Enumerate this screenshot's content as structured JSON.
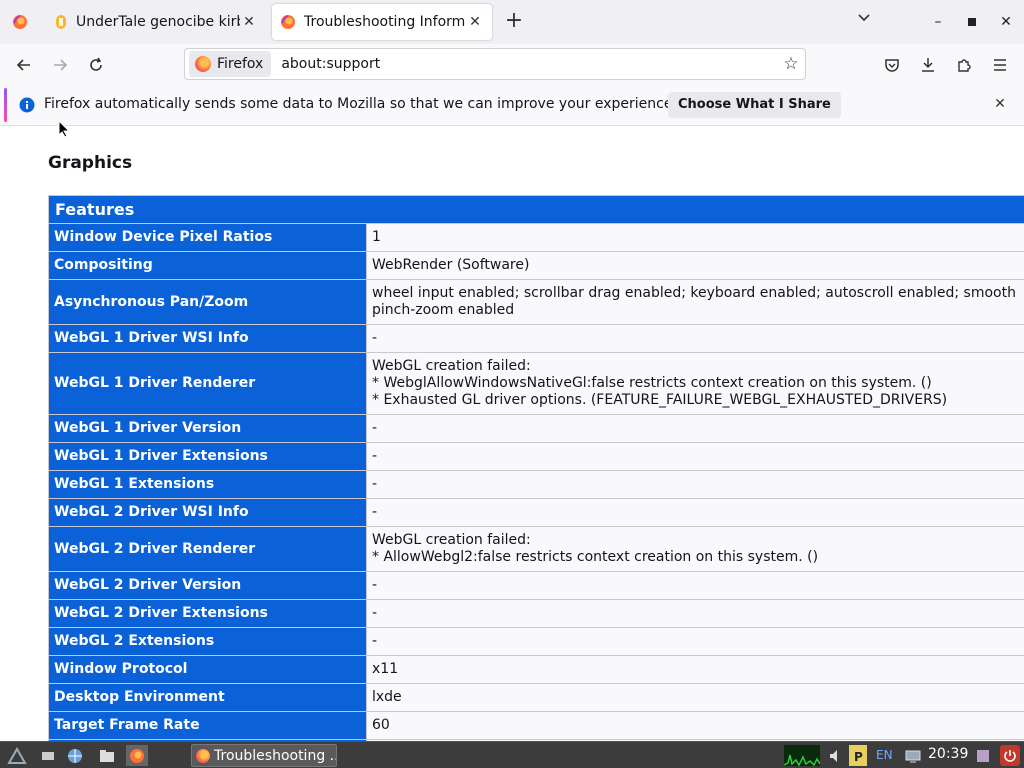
{
  "tabs": [
    {
      "title": "UnderTale genocibe kirby",
      "active": false
    },
    {
      "title": "Troubleshooting Informat",
      "active": true
    }
  ],
  "toolbar": {
    "identity_label": "Firefox",
    "url": "about:support"
  },
  "notification": {
    "message": "Firefox automatically sends some data to Mozilla so that we can improve your experience.",
    "button_label": "Choose What I Share"
  },
  "page": {
    "section_title": "Graphics",
    "table_caption": "Features",
    "rows": [
      {
        "key": "Window Device Pixel Ratios",
        "value": "1"
      },
      {
        "key": "Compositing",
        "value": "WebRender (Software)"
      },
      {
        "key": "Asynchronous Pan/Zoom",
        "value": "wheel input enabled; scrollbar drag enabled; keyboard enabled; autoscroll enabled; smooth pinch-zoom enabled"
      },
      {
        "key": "WebGL 1 Driver WSI Info",
        "value": "-"
      },
      {
        "key": "WebGL 1 Driver Renderer",
        "value": "WebGL creation failed:\n* WebglAllowWindowsNativeGl:false restricts context creation on this system. ()\n* Exhausted GL driver options. (FEATURE_FAILURE_WEBGL_EXHAUSTED_DRIVERS)"
      },
      {
        "key": "WebGL 1 Driver Version",
        "value": "-"
      },
      {
        "key": "WebGL 1 Driver Extensions",
        "value": "-"
      },
      {
        "key": "WebGL 1 Extensions",
        "value": "-"
      },
      {
        "key": "WebGL 2 Driver WSI Info",
        "value": "-"
      },
      {
        "key": "WebGL 2 Driver Renderer",
        "value": "WebGL creation failed:\n* AllowWebgl2:false restricts context creation on this system. ()"
      },
      {
        "key": "WebGL 2 Driver Version",
        "value": "-"
      },
      {
        "key": "WebGL 2 Driver Extensions",
        "value": "-"
      },
      {
        "key": "WebGL 2 Extensions",
        "value": "-"
      },
      {
        "key": "Window Protocol",
        "value": "x11"
      },
      {
        "key": "Desktop Environment",
        "value": "lxde"
      },
      {
        "key": "Target Frame Rate",
        "value": "60"
      },
      {
        "key": "",
        "value": "{"
      }
    ]
  },
  "taskbar": {
    "task_label": "Troubleshooting ...",
    "language": "EN",
    "clock": "20:39"
  },
  "colors": {
    "table_header_bg": "#0a61d8",
    "table_value_bg": "#f9f9fb"
  }
}
